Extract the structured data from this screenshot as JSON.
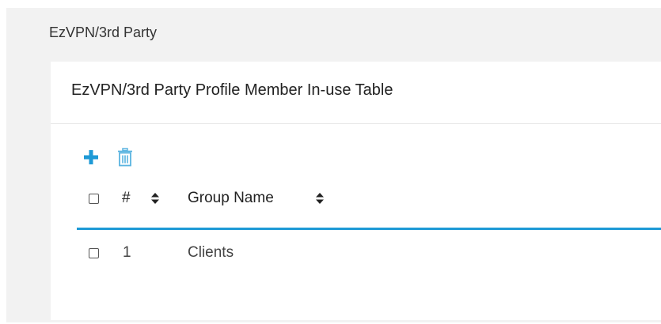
{
  "breadcrumb": "EzVPN/3rd Party",
  "card": {
    "title": "EzVPN/3rd Party Profile Member In-use Table"
  },
  "toolbar": {
    "add_icon": "plus-icon",
    "delete_icon": "trash-icon"
  },
  "table": {
    "columns": [
      {
        "label": "#",
        "sortable": true
      },
      {
        "label": "Group Name",
        "sortable": true
      }
    ],
    "rows": [
      {
        "index": "1",
        "group_name": "Clients",
        "checked": false
      }
    ]
  },
  "colors": {
    "accent": "#1e9ad6",
    "background": "#f2f2f2",
    "card": "#ffffff"
  }
}
